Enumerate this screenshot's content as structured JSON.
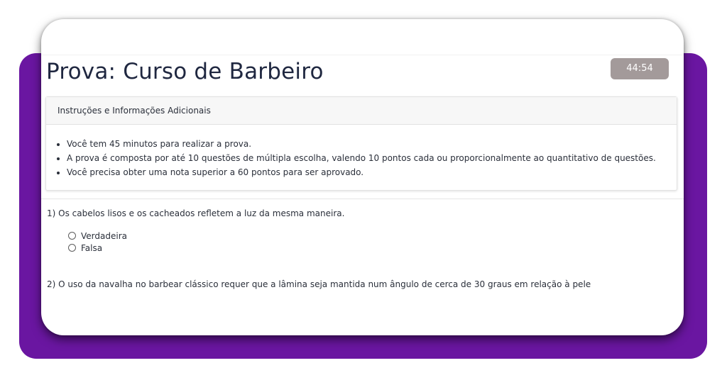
{
  "page": {
    "title": "Prova: Curso de Barbeiro",
    "timer": "44:54",
    "colors": {
      "accent_background": "#6a16a1",
      "timer_background": "#a39a9a",
      "text": "#1f2740"
    }
  },
  "instructions": {
    "header": "Instruções e Informações Adicionais",
    "items": [
      "Você tem 45 minutos para realizar a prova.",
      "A prova é composta por até 10 questões de múltipla escolha, valendo 10 pontos cada ou proporcionalmente ao quantitativo de questões.",
      "Você precisa obter uma nota superior a 60 pontos para ser aprovado."
    ]
  },
  "questions": [
    {
      "text": "1) Os cabelos lisos e os cacheados refletem a luz da mesma maneira.",
      "options": [
        "Verdadeira",
        "Falsa"
      ]
    },
    {
      "text": "2) O uso da navalha no barbear clássico requer que a lâmina seja mantida num ângulo de cerca de 30 graus em relação à pele"
    }
  ]
}
